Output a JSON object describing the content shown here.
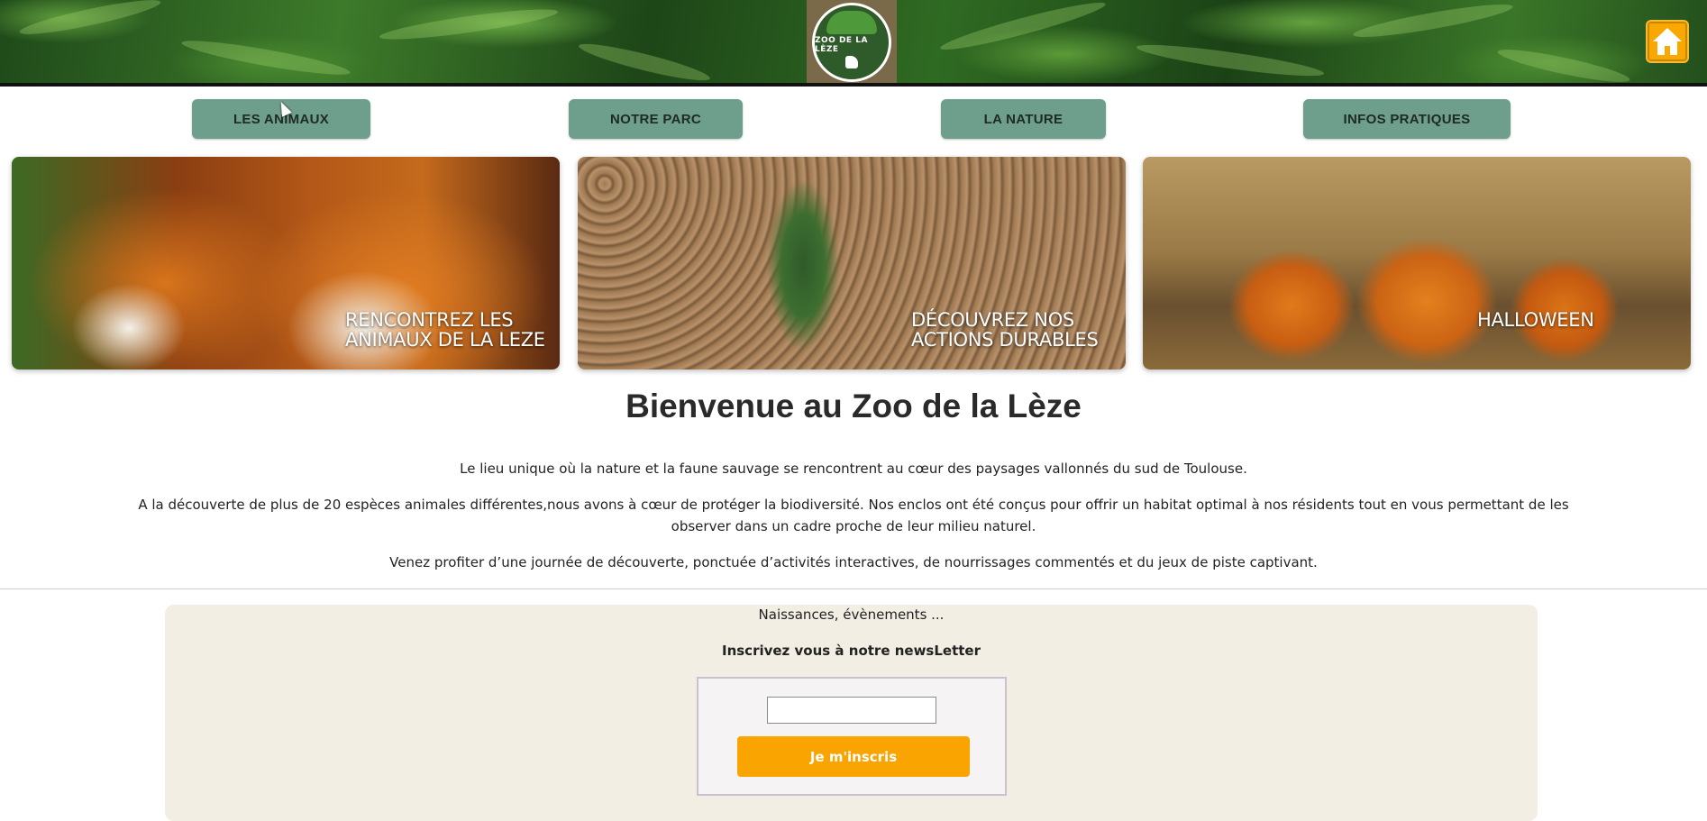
{
  "header": {
    "logo_text": "ZOO DE LA LÈZE",
    "home_icon": "home-icon",
    "accent_color": "#f8a800"
  },
  "nav": {
    "items": [
      {
        "label": "LES ANIMAUX"
      },
      {
        "label": "NOTRE PARC"
      },
      {
        "label": "LA NATURE"
      },
      {
        "label": "INFOS PRATIQUES"
      }
    ],
    "button_color": "#6e9e8c"
  },
  "cards": [
    {
      "caption_line1": "Rencontrez les",
      "caption_line2": "animaux de la Leze"
    },
    {
      "caption_line1": "Découvrez nos",
      "caption_line2": "actions durables"
    },
    {
      "caption_line1": "Halloween",
      "caption_line2": ""
    }
  ],
  "welcome": {
    "title": "Bienvenue au Zoo de la Lèze",
    "p1": "Le lieu unique où la nature et la faune sauvage se rencontrent au cœur des paysages vallonnés du sud de Toulouse.",
    "p2": "A la découverte de plus de 20 espèces animales différentes,nous avons à cœur de protéger la biodiversité. Nos enclos ont été conçus pour offrir un habitat optimal à nos résidents tout en vous permettant de les observer dans un cadre proche de leur milieu naturel.",
    "p3": "Venez profiter d’une journée de découverte, ponctuée d’activités interactives, de nourrissages commentés et du jeux de piste captivant."
  },
  "newsletter": {
    "intro": "Naissances, évènements ...",
    "headline": "Inscrivez vous à notre newsLetter",
    "email_value": "",
    "submit_label": "Je m'inscris",
    "submit_color": "#f9a400"
  }
}
